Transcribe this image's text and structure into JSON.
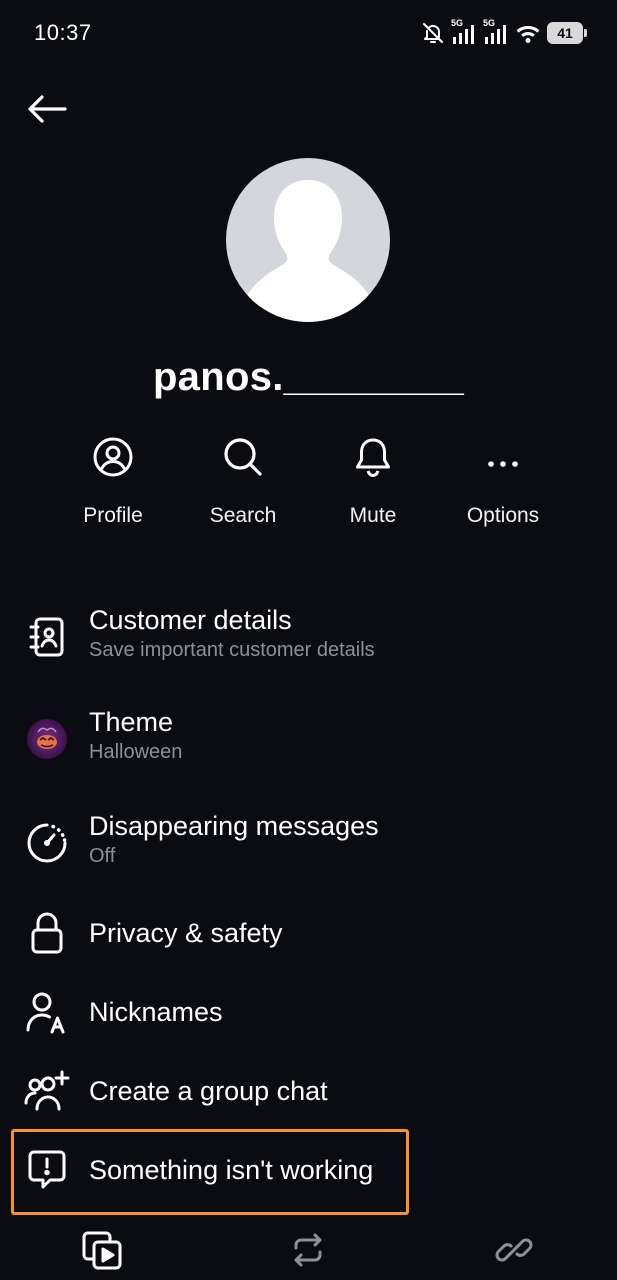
{
  "status_bar": {
    "time": "10:37",
    "network_1": "5G",
    "network_2": "5G",
    "battery_level": "41"
  },
  "header": {
    "back_icon": "arrow-left-icon"
  },
  "profile": {
    "avatar_icon": "default-avatar-icon",
    "username": "panos.________"
  },
  "actions": [
    {
      "label": "Profile",
      "icon": "user-circle-icon"
    },
    {
      "label": "Search",
      "icon": "search-icon"
    },
    {
      "label": "Mute",
      "icon": "bell-icon"
    },
    {
      "label": "Options",
      "icon": "more-horizontal-icon"
    }
  ],
  "menu": {
    "customer_details": {
      "title": "Customer details",
      "subtitle": "Save important customer details",
      "icon": "contact-book-icon"
    },
    "theme": {
      "title": "Theme",
      "subtitle": "Halloween",
      "icon": "halloween-theme-icon"
    },
    "disappearing": {
      "title": "Disappearing messages",
      "subtitle": "Off",
      "icon": "timer-dashed-icon"
    },
    "privacy": {
      "title": "Privacy & safety",
      "icon": "lock-icon"
    },
    "nicknames": {
      "title": "Nicknames",
      "icon": "person-letter-a-icon"
    },
    "group_chat": {
      "title": "Create a group chat",
      "icon": "group-add-icon"
    },
    "report": {
      "title": "Something isn't working",
      "icon": "report-speech-bubble-icon"
    }
  },
  "bottom_bar": [
    {
      "icon": "media-gallery-icon"
    },
    {
      "icon": "repeat-icon"
    },
    {
      "icon": "link-icon"
    }
  ],
  "colors": {
    "background": "#0b0c11",
    "text_primary": "#ffffff",
    "text_secondary": "#8e9097",
    "highlight_border": "#f7931e",
    "avatar_bg": "#d3d6db"
  }
}
